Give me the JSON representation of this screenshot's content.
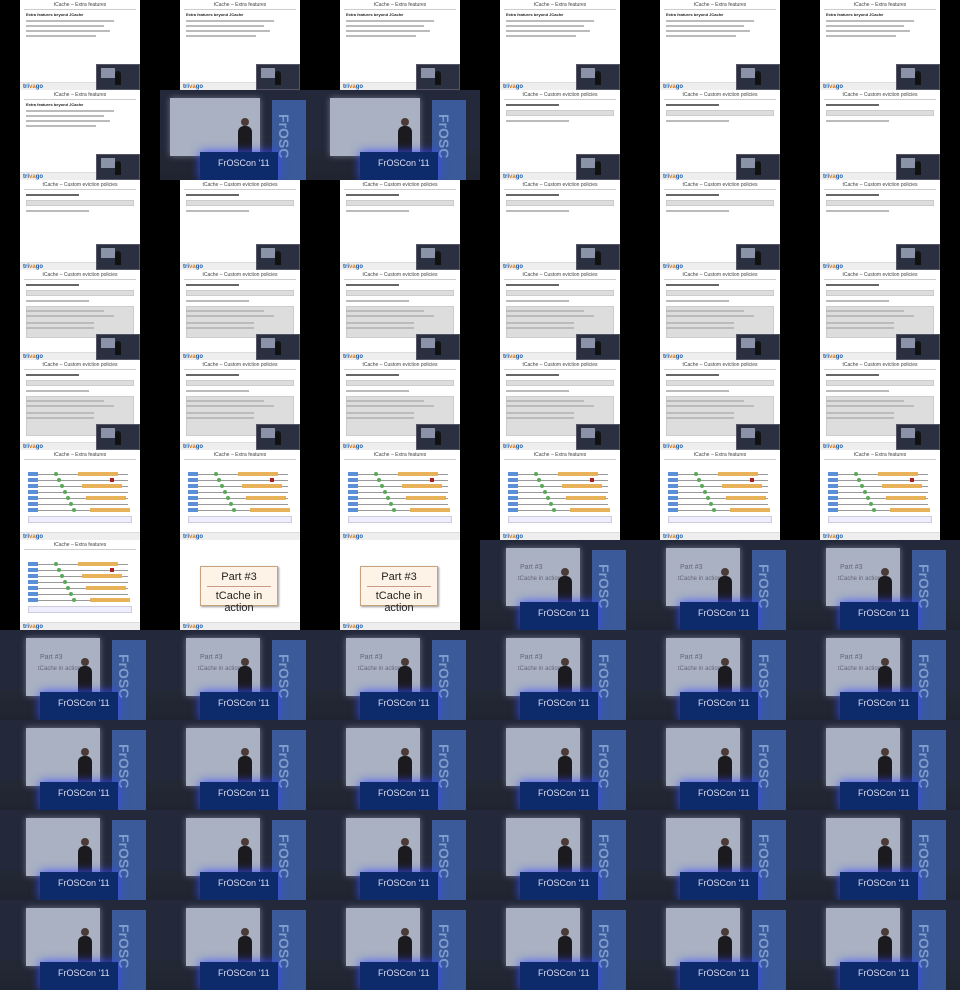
{
  "slides": {
    "extra_title": "tCache – Extra features",
    "extra_heading": "Extra features beyond JCache",
    "custom_title": "tCache – Custom eviction policies",
    "logo_tri": "tri",
    "logo_va": "va",
    "logo_go": "go",
    "part_number": "Part #3",
    "part_subtitle": "tCache in action",
    "lectern_text": "FrOSCon '11",
    "banner_text": "FrOSC"
  },
  "cells": [
    "extra",
    "extra",
    "extra",
    "extra",
    "extra",
    "extra",
    "extra",
    "stage-photo",
    "stage-photo",
    "custom",
    "custom",
    "custom",
    "custom",
    "custom",
    "custom",
    "custom",
    "custom",
    "custom",
    "custom-code",
    "custom-code",
    "custom-code",
    "custom-code",
    "custom-code",
    "custom-code",
    "custom-code2",
    "custom-code2",
    "custom-code2",
    "custom-code2",
    "custom-code2",
    "custom-code2",
    "diagram",
    "diagram",
    "diagram",
    "diagram",
    "diagram",
    "diagram",
    "diagram",
    "part",
    "part",
    "stage",
    "stage",
    "stage",
    "stage",
    "stage",
    "stage",
    "stage",
    "stage",
    "stage",
    "stage",
    "stage",
    "stage",
    "stage",
    "stage",
    "stage",
    "stage",
    "stage",
    "stage",
    "stage",
    "stage",
    "stage",
    "stage",
    "stage",
    "stage",
    "stage",
    "stage",
    "stage"
  ],
  "colors": {
    "accent_orange": "#e8b25a",
    "accent_blue": "#5b8fd8",
    "accent_green": "#5aa85a",
    "accent_red": "#b02020"
  }
}
